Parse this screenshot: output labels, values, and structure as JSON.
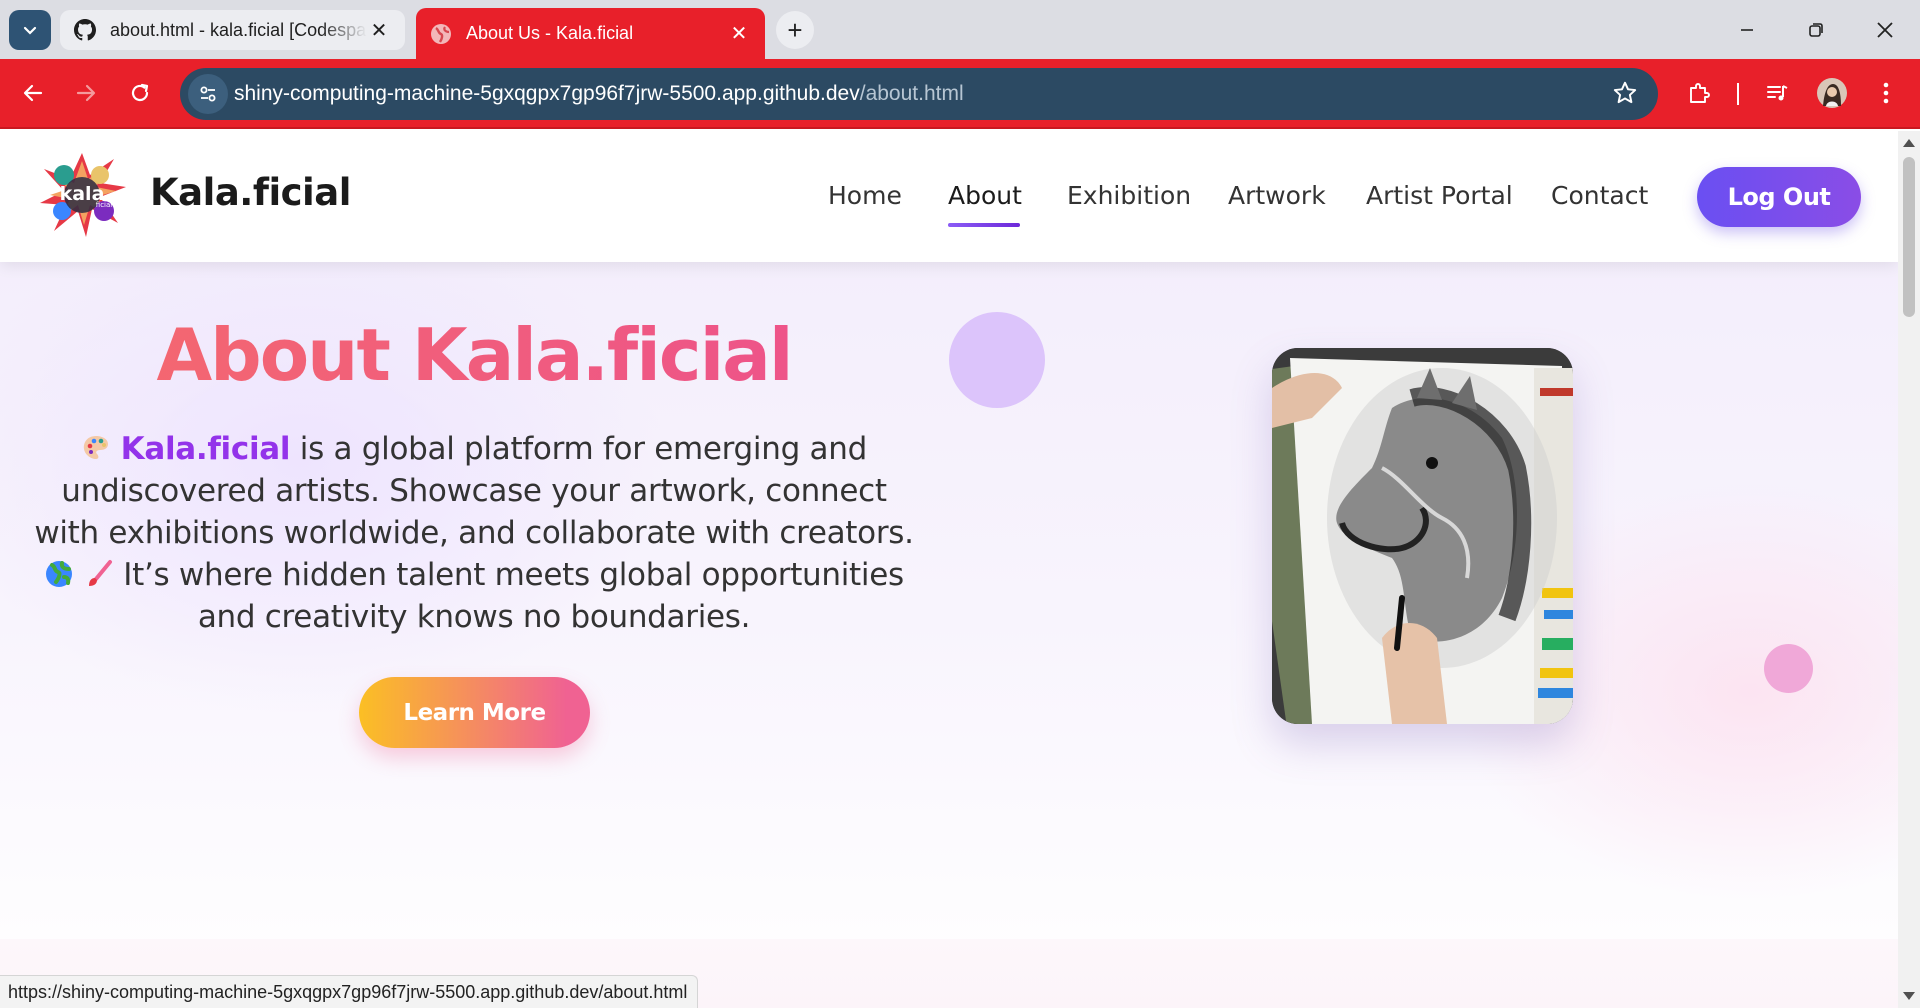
{
  "browser": {
    "tabs": [
      {
        "title": "about.html - kala.ficial [Codespaces]",
        "icon": "github-icon"
      },
      {
        "title": "About Us - Kala.ficial",
        "icon": "globe-icon",
        "active": true
      }
    ],
    "url_host": "shiny-computing-machine-5gxqgpx7gp96f7jrw-5500.app.github.dev",
    "url_path": "/about.html",
    "status_url": "https://shiny-computing-machine-5gxqgpx7gp96f7jrw-5500.app.github.dev/about.html",
    "accent_color": "#e8202a"
  },
  "site": {
    "brand": "Kala.ficial",
    "logo_text": "kala",
    "logo_subtext": "ficial",
    "nav": [
      {
        "label": "Home"
      },
      {
        "label": "About",
        "active": true
      },
      {
        "label": "Exhibition"
      },
      {
        "label": "Artwork"
      },
      {
        "label": "Artist Portal"
      },
      {
        "label": "Contact"
      }
    ],
    "logout_label": "Log Out"
  },
  "hero": {
    "title": "About Kala.ficial",
    "brand_word": "Kala.ficial",
    "text_1": " is a global platform for emerging and undiscovered artists. Showcase your artwork, connect with exhibitions worldwide, and collaborate with creators. ",
    "text_2": " It’s where hidden talent meets global opportunities and creativity knows no boundaries.",
    "button_label": "Learn More",
    "image_subject": "pencil drawing of a horse"
  }
}
